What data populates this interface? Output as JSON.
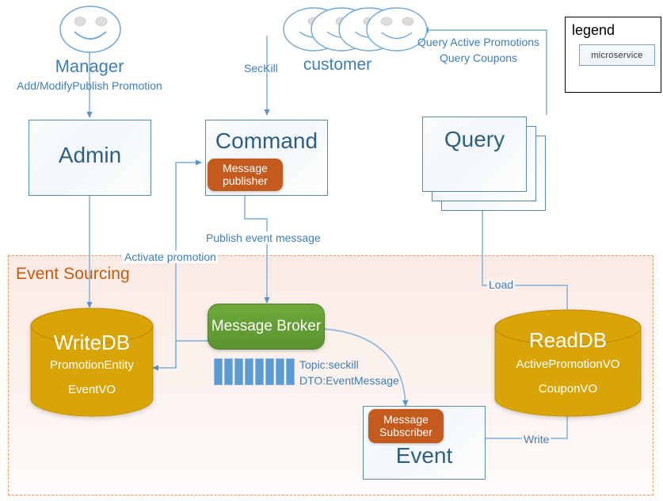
{
  "diagram": {
    "title": "CQRS / Event Sourcing microservice architecture",
    "colors": {
      "connector": "#8FB8DC",
      "box_border": "#5B87A8",
      "box_title_text": "#2E5E80",
      "label_text": "#3E7EB5",
      "pill_fill": "#C55A1E",
      "broker_fill": "#6CA939",
      "db_fill": "#D9A406",
      "region_border": "#E8965A",
      "region_fill": "#FBEAE4",
      "region_label": "#C55A11",
      "queue_cell": "#5B9BD5"
    }
  },
  "actors": {
    "manager": {
      "name": "Manager",
      "caption": "Add/ModifyPublish Promotion",
      "icon": "smiley-face-icon"
    },
    "customer": {
      "name": "customer",
      "icon": "smiley-face-stack-icon",
      "face_count": 4
    }
  },
  "region": {
    "label": "Event Sourcing"
  },
  "legend": {
    "title": "legend",
    "items": [
      {
        "label": "microservice",
        "shape": "rounded-rect"
      }
    ]
  },
  "nodes": {
    "admin": {
      "label": "Admin",
      "type": "microservice"
    },
    "command": {
      "label": "Command",
      "type": "microservice"
    },
    "query": {
      "label": "Query",
      "type": "microservice",
      "stack_count": 3
    },
    "event": {
      "label": "Event",
      "type": "microservice"
    },
    "message_publisher": {
      "line1": "Message",
      "line2": "publisher",
      "type": "component"
    },
    "message_subscriber": {
      "line1": "Message",
      "line2": "Subscriber",
      "type": "component"
    },
    "message_broker": {
      "label": "Message Broker",
      "type": "broker"
    },
    "write_db": {
      "title": "WriteDB",
      "line1": "PromotionEntity",
      "line2": "EventVO",
      "type": "database"
    },
    "read_db": {
      "title": "ReadDB",
      "line1": "ActivePromotionVO",
      "line2": "CouponVO",
      "type": "database"
    }
  },
  "broker_meta": {
    "topic": "Topic:seckill",
    "dto": "DTO:EventMessage",
    "queue_cells": 8
  },
  "edges": [
    {
      "id": "manager-admin",
      "label": "",
      "from": "manager",
      "to": "admin"
    },
    {
      "id": "customer-command",
      "label": "SecKill",
      "from": "customer",
      "to": "command"
    },
    {
      "id": "query-customer",
      "label": "Query Active Promotions",
      "label2": "Query Coupons",
      "from": "query",
      "to": "customer"
    },
    {
      "id": "admin-writedb",
      "label": "",
      "from": "admin",
      "to": "write_db"
    },
    {
      "id": "writedb-command",
      "label": "Activate promotion",
      "from": "write_db",
      "to": "command"
    },
    {
      "id": "publisher-broker",
      "label": "Publish event message",
      "from": "message_publisher",
      "to": "message_broker"
    },
    {
      "id": "broker-writedb",
      "label": "",
      "from": "message_broker",
      "to": "write_db"
    },
    {
      "id": "broker-subscriber",
      "label": "",
      "from": "message_broker",
      "to": "message_subscriber"
    },
    {
      "id": "event-readdb",
      "label": "Write",
      "from": "event",
      "to": "read_db"
    },
    {
      "id": "readdb-query",
      "label": "Load",
      "from": "read_db",
      "to": "query"
    }
  ]
}
